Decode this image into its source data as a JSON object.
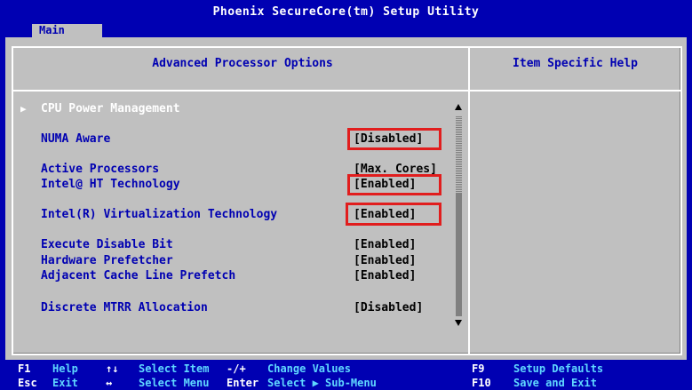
{
  "window": {
    "title": "Phoenix SecureCore(tm) Setup Utility"
  },
  "tabs": [
    {
      "label": "Main"
    }
  ],
  "panel": {
    "title": "Advanced Processor Options",
    "help_title": "Item Specific Help"
  },
  "items": [
    {
      "label": "CPU Power Management",
      "value": ""
    },
    {
      "label": "NUMA Aware",
      "value": "[Disabled]"
    },
    {
      "label": "Active Processors",
      "value": "[Max. Cores]"
    },
    {
      "label": "Intel@ HT Technology",
      "value": "[Enabled]"
    },
    {
      "label": "Intel(R) Virtualization Technology",
      "value": "[Enabled]"
    },
    {
      "label": "Execute Disable Bit",
      "value": "[Enabled]"
    },
    {
      "label": "Hardware Prefetcher",
      "value": "[Enabled]"
    },
    {
      "label": "Adjacent Cache Line Prefetch",
      "value": "[Enabled]"
    },
    {
      "label": "Discrete MTRR Allocation",
      "value": "[Disabled]"
    }
  ],
  "footer": {
    "row1": [
      {
        "key": "F1",
        "action": "Help"
      },
      {
        "key": "↑↓",
        "action": "Select Item"
      },
      {
        "key": "-/+",
        "action": "Change Values"
      },
      {
        "key": "F9",
        "action": "Setup Defaults"
      }
    ],
    "row2": [
      {
        "key": "Esc",
        "action": "Exit"
      },
      {
        "key": "↔",
        "action": "Select Menu"
      },
      {
        "key": "Enter",
        "action": "Select ▶ Sub-Menu"
      },
      {
        "key": "F10",
        "action": "Save and Exit"
      }
    ]
  },
  "colors": {
    "background": "#0000b2",
    "panel": "#c0c0c0",
    "highlight_box": "#e11d1d"
  }
}
